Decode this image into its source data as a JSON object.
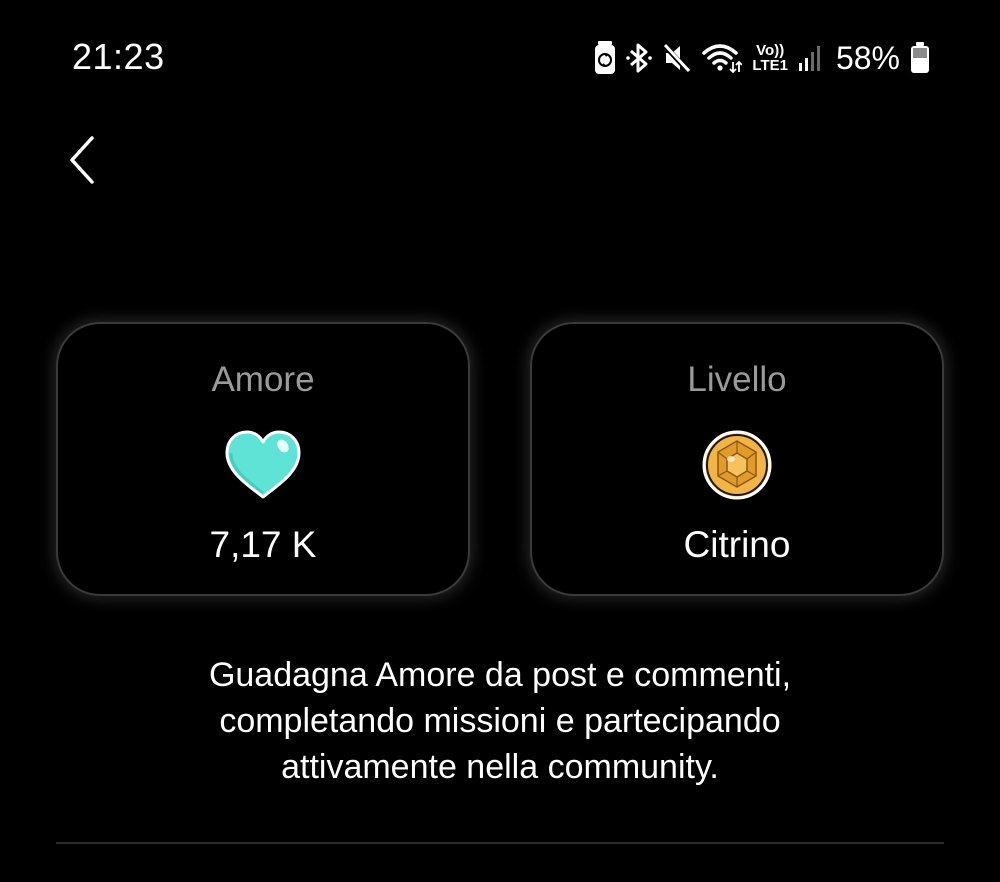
{
  "status_bar": {
    "time": "21:23",
    "icons": [
      "battery-saver-icon",
      "bluetooth-icon",
      "mute-icon",
      "wifi-icon",
      "volte-lte1-icon",
      "signal-icon"
    ],
    "volte_label": "Vo))",
    "lte_label": "LTE1",
    "battery_percent": "58%",
    "battery_level": 0.58
  },
  "nav": {
    "back_icon": "chevron-left-icon"
  },
  "cards": {
    "love": {
      "title": "Amore",
      "icon": "heart-icon",
      "value": "7,17 K",
      "icon_color": "#5fe3d6"
    },
    "level": {
      "title": "Livello",
      "icon": "citrine-gem-icon",
      "value": "Citrino",
      "icon_color": "#f2b347"
    }
  },
  "description": {
    "line1": "Guadagna Amore da post e commenti,",
    "line2": "completando missioni e partecipando",
    "line3": "attivamente nella community."
  },
  "colors": {
    "background": "#000000",
    "card_border": "#3a3a3a",
    "muted_text": "#9a9a9a"
  }
}
